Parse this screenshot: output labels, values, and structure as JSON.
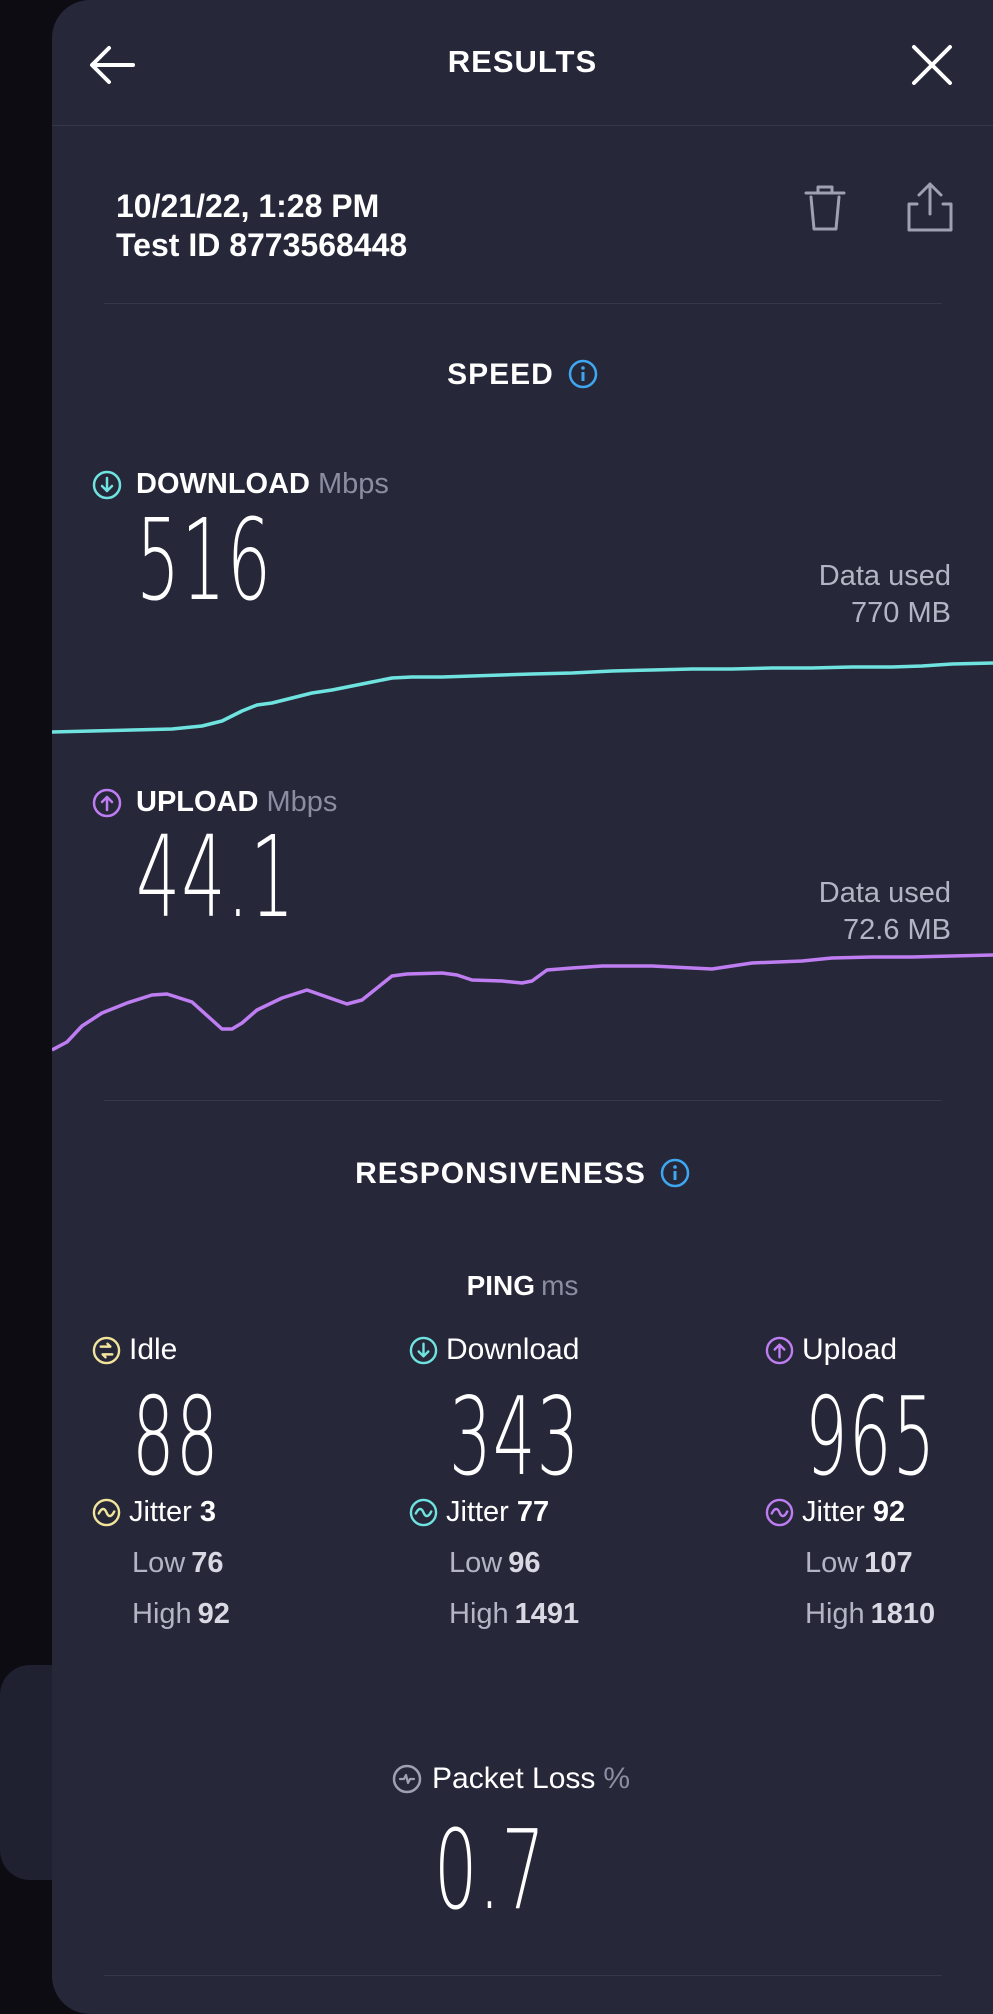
{
  "header": {
    "title": "RESULTS"
  },
  "test": {
    "datetime": "10/21/22, 1:28 PM",
    "test_id": "Test ID 8773568448"
  },
  "speed": {
    "title": "SPEED",
    "download": {
      "label": "DOWNLOAD",
      "unit": "Mbps",
      "value": "516",
      "data_used_label": "Data used",
      "data_used": "770 MB",
      "color": "#6fe3df"
    },
    "upload": {
      "label": "UPLOAD",
      "unit": "Mbps",
      "value": "44.1",
      "data_used_label": "Data used",
      "data_used": "72.6 MB",
      "color": "#bf7df2"
    }
  },
  "responsiveness": {
    "title": "RESPONSIVENESS",
    "ping_label": "PING",
    "ping_unit": "ms",
    "columns": [
      {
        "label": "Idle",
        "value": "88",
        "jitter_label": "Jitter",
        "jitter": "3",
        "low_label": "Low",
        "low": "76",
        "high_label": "High",
        "high": "92",
        "color": "#f2e49a"
      },
      {
        "label": "Download",
        "value": "343",
        "jitter_label": "Jitter",
        "jitter": "77",
        "low_label": "Low",
        "low": "96",
        "high_label": "High",
        "high": "1491",
        "color": "#6fe3df"
      },
      {
        "label": "Upload",
        "value": "965",
        "jitter_label": "Jitter",
        "jitter": "92",
        "low_label": "Low",
        "low": "107",
        "high_label": "High",
        "high": "1810",
        "color": "#bf7df2"
      }
    ],
    "packet_loss": {
      "label": "Packet Loss",
      "unit": "%",
      "value": "0.7"
    }
  },
  "icons": {
    "back": "arrow-left-icon",
    "close": "close-icon",
    "trash": "trash-icon",
    "share": "share-icon",
    "info": "info-icon",
    "download": "arrow-down-circle-icon",
    "upload": "arrow-up-circle-icon",
    "idle": "idle-circle-icon",
    "jitter": "wave-circle-icon",
    "packet_loss": "packet-loss-icon"
  },
  "colors": {
    "background": "#262739",
    "accent_blue": "#3fa6f0"
  }
}
